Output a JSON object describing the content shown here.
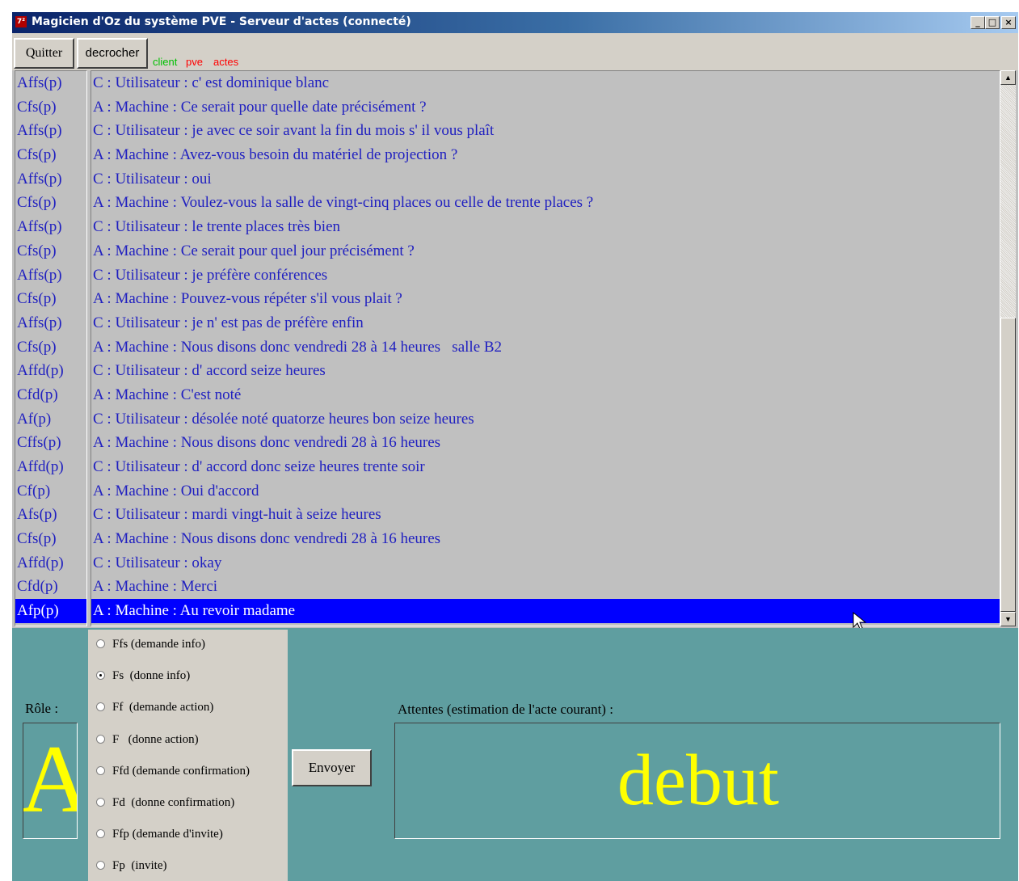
{
  "window": {
    "title": "Magicien d'Oz du système PVE - Serveur d'actes (connecté)",
    "app_icon": "7²",
    "controls": {
      "minimize": "_",
      "maximize": "□",
      "close": "×"
    }
  },
  "toolbar": {
    "quit_label": "Quitter",
    "decrocher_label": "decrocher",
    "status_client": "client",
    "status_pve": "pve",
    "status_actes": "actes"
  },
  "colors": {
    "status_ok": "#00c000",
    "status_off": "#ff0000",
    "list_text": "#2020c0",
    "selection": "#0000ff",
    "panel_bg": "#5f9ea0",
    "highlight_text": "#ffff00"
  },
  "acts": [
    {
      "code": "Affs(p)",
      "text": "C : Utilisateur : c' est dominique blanc"
    },
    {
      "code": "Cfs(p)",
      "text": "A : Machine : Ce serait pour quelle date précisément ?"
    },
    {
      "code": "Affs(p)",
      "text": "C : Utilisateur : je avec ce soir avant la fin du mois s' il vous plaît"
    },
    {
      "code": "Cfs(p)",
      "text": "A : Machine : Avez-vous besoin du matériel de projection ?"
    },
    {
      "code": "Affs(p)",
      "text": "C : Utilisateur : oui"
    },
    {
      "code": "Cfs(p)",
      "text": "A : Machine : Voulez-vous la salle de vingt-cinq places ou celle de trente places ?"
    },
    {
      "code": "Affs(p)",
      "text": "C : Utilisateur : le trente places très bien"
    },
    {
      "code": "Cfs(p)",
      "text": "A : Machine : Ce serait pour quel jour précisément ?"
    },
    {
      "code": "Affs(p)",
      "text": "C : Utilisateur : je préfère conférences"
    },
    {
      "code": "Cfs(p)",
      "text": "A : Machine : Pouvez-vous répéter s'il vous plait ?"
    },
    {
      "code": "Affs(p)",
      "text": "C : Utilisateur : je n' est pas de préfère enfin"
    },
    {
      "code": "Cfs(p)",
      "text": "A : Machine : Nous disons donc vendredi 28 à 14 heures   salle B2"
    },
    {
      "code": "Affd(p)",
      "text": "C : Utilisateur : d' accord seize heures"
    },
    {
      "code": "Cfd(p)",
      "text": "A : Machine : C'est noté"
    },
    {
      "code": "Af(p)",
      "text": "C : Utilisateur : désolée noté quatorze heures bon seize heures"
    },
    {
      "code": "Cffs(p)",
      "text": "A : Machine : Nous disons donc vendredi 28 à 16 heures"
    },
    {
      "code": "Affd(p)",
      "text": "C : Utilisateur : d' accord donc seize heures trente soir"
    },
    {
      "code": "Cf(p)",
      "text": "A : Machine : Oui d'accord"
    },
    {
      "code": "Afs(p)",
      "text": "C : Utilisateur : mardi vingt-huit à seize heures"
    },
    {
      "code": "Cfs(p)",
      "text": "A : Machine : Nous disons donc vendredi 28 à 16 heures"
    },
    {
      "code": "Affd(p)",
      "text": "C : Utilisateur : okay"
    },
    {
      "code": "Cfd(p)",
      "text": "A : Machine : Merci"
    },
    {
      "code": "Afp(p)",
      "text": "A : Machine : Au revoir madame",
      "selected": true
    }
  ],
  "role": {
    "label": "Rôle :",
    "value": "A"
  },
  "act_types": [
    {
      "label": "Ffs (demande info)",
      "checked": false
    },
    {
      "label": "Fs  (donne info)",
      "checked": true
    },
    {
      "label": "Ff  (demande action)",
      "checked": false
    },
    {
      "label": "F   (donne action)",
      "checked": false
    },
    {
      "label": "Ffd (demande confirmation)",
      "checked": false
    },
    {
      "label": "Fd  (donne confirmation)",
      "checked": false
    },
    {
      "label": "Ffp (demande d'invite)",
      "checked": false
    },
    {
      "label": "Fp  (invite)",
      "checked": false
    }
  ],
  "send_label": "Envoyer",
  "attentes": {
    "label": "Attentes (estimation de l'acte courant) :",
    "value": "debut"
  }
}
